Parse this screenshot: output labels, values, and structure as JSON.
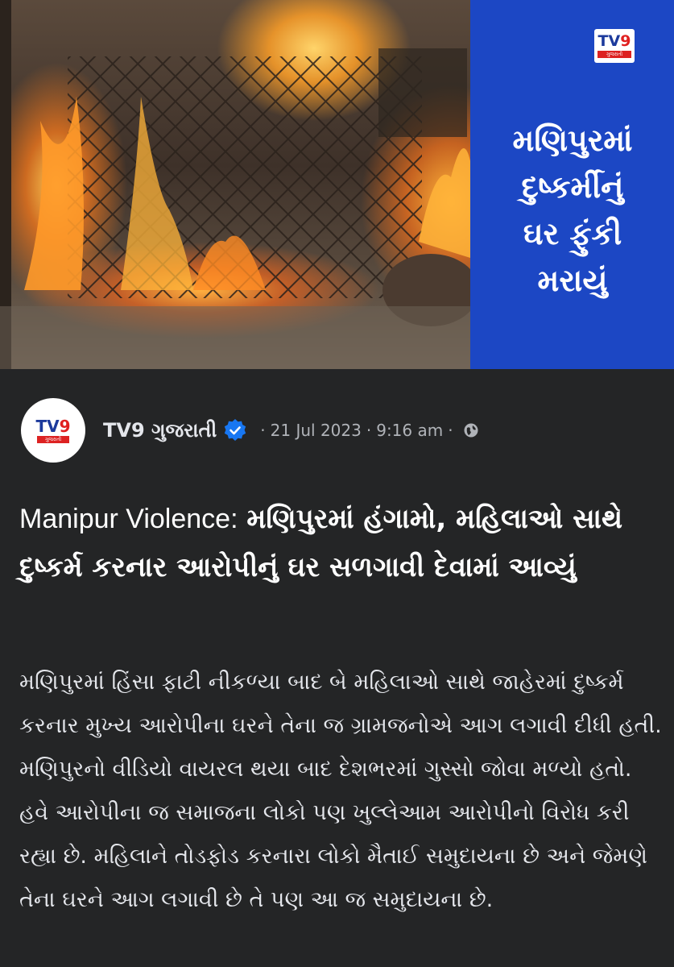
{
  "hero": {
    "logo_text": "TV9",
    "logo_sub": "ગુજરાતી",
    "headline": "મણિપુરમાં\nદુષ્કર્મીનું\nઘર ફુંકી\nમરાયું"
  },
  "post": {
    "page_name": "TV9 ગુજરાતી",
    "date": "21 Jul 2023",
    "time": "9:16 am",
    "separator": "·",
    "title_en": "Manipur Violence:",
    "title_gu": "મણિપુરમાં હંગામો, મહિલાઓ સાથે દુષ્કર્મ કરનાર આરોપીનું ઘર સળગાવી દેવામાં આવ્યું",
    "body": "મણિપુરમાં હિંસા ફાટી નીકળ્યા બાદ બે મહિલાઓ સાથે જાહેરમાં દુષ્કર્મ કરનાર મુખ્ય આરોપીના ઘરને તેના જ ગ્રામજનોએ આગ લગાવી દીધી હતી. મણિપુરનો વીડિયો વાયરલ થયા બાદ દેશભરમાં ગુસ્સો જોવા મળ્યો હતો. હવે આરોપીના જ સમાજના લોકો પણ ખુલ્લેઆમ આરોપીનો વિરોધ કરી રહ્યા છે. મહિલાને તોડફોડ કરનારા લોકો મૈતાઈ સમુદાયના છે અને જેમણે તેના ઘરને આગ લગાવી છે તે પણ આ જ સમુદાયના છે."
  },
  "colors": {
    "background": "#242526",
    "panel_blue": "#1c47c4",
    "verified_blue": "#1877f2",
    "meta_gray": "#b0b3b8"
  },
  "icons": {
    "verified": "verified-badge-icon",
    "audience": "globe-icon"
  }
}
